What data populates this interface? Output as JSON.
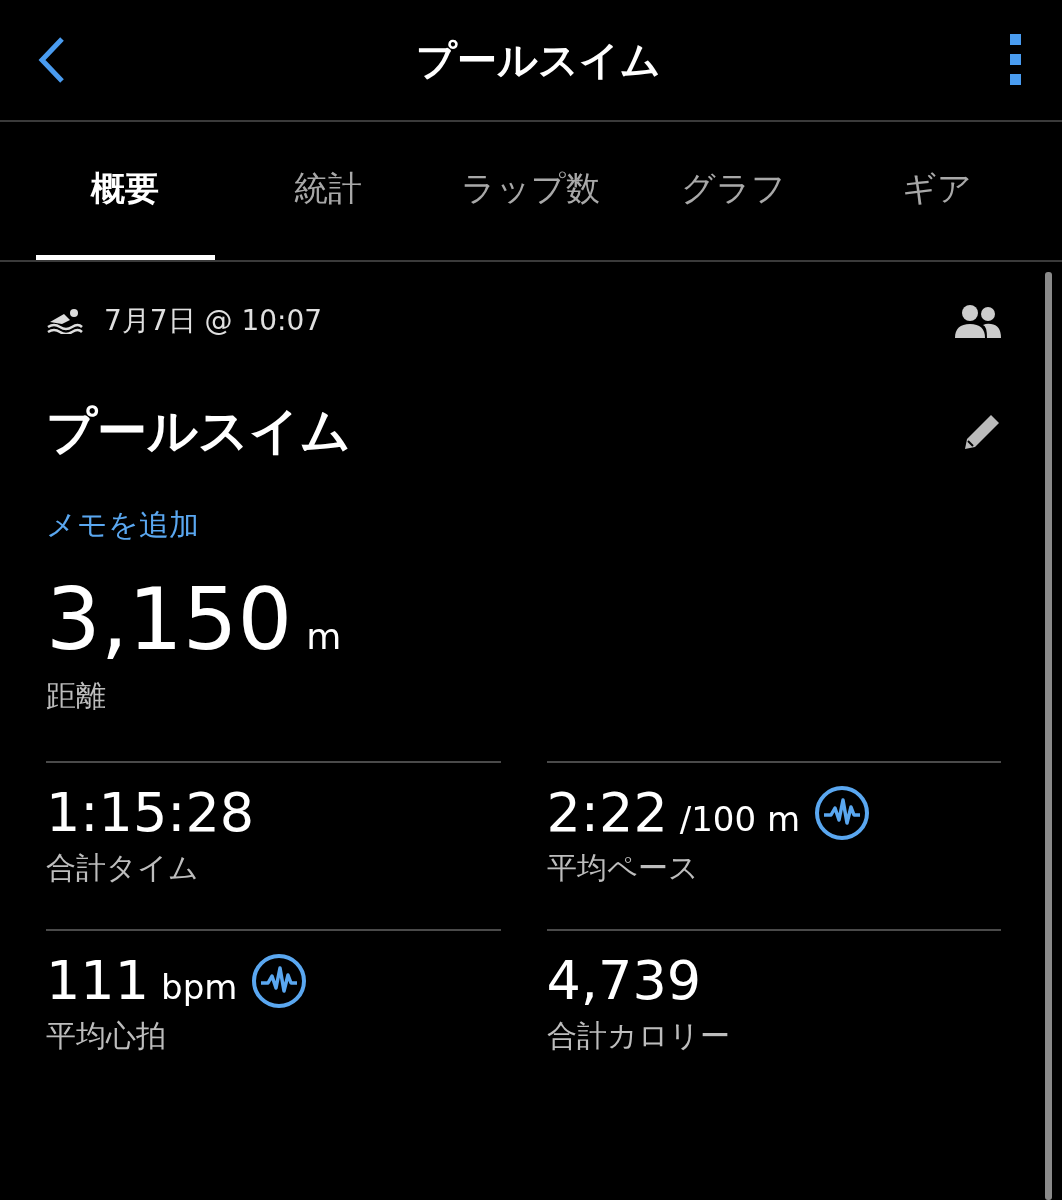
{
  "header": {
    "title": "プールスイム"
  },
  "tabs": [
    {
      "label": "概要",
      "selected": true
    },
    {
      "label": "統計",
      "selected": false
    },
    {
      "label": "ラップ数",
      "selected": false
    },
    {
      "label": "グラフ",
      "selected": false
    },
    {
      "label": "ギア",
      "selected": false
    }
  ],
  "activity": {
    "date": "7月7日 @ 10:07",
    "name": "プールスイム",
    "add_note": "メモを追加"
  },
  "distance": {
    "value": "3,150",
    "unit": "m",
    "label": "距離"
  },
  "metrics": [
    {
      "value": "1:15:28",
      "label": "合計タイム",
      "chart_link": false
    },
    {
      "value": "2:22",
      "unit": "/100 m",
      "label": "平均ペース",
      "chart_link": true
    },
    {
      "value": "111",
      "unit": "bpm",
      "label": "平均心拍",
      "chart_link": true
    },
    {
      "value": "4,739",
      "label": "合計カロリー",
      "chart_link": false
    }
  ]
}
